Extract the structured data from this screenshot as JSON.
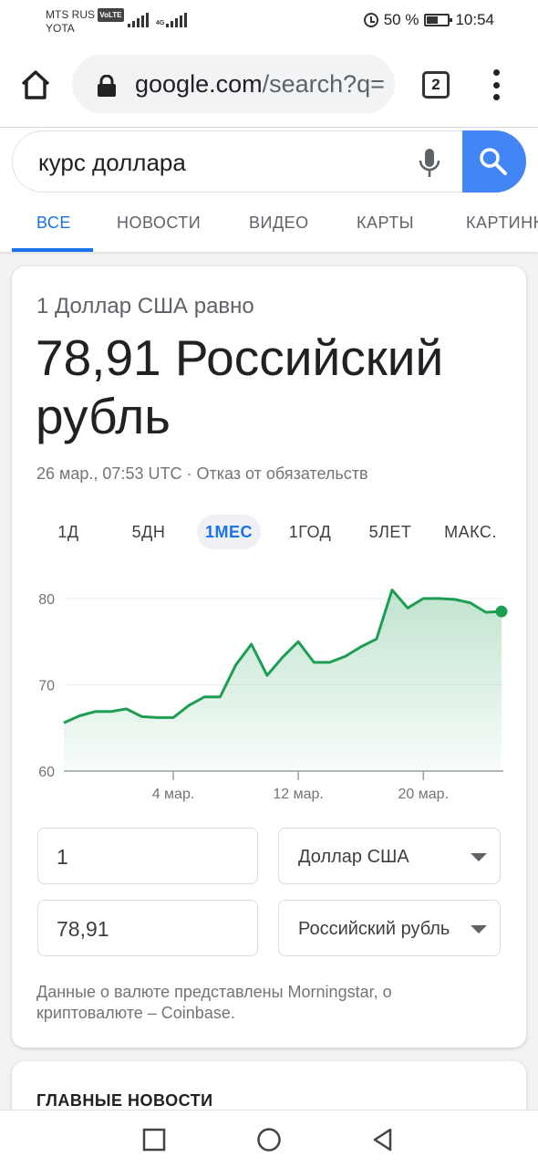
{
  "status_bar": {
    "carrier1": "MTS RUS",
    "volte": "VoLTE",
    "carrier2": "YOTA",
    "network": "4G",
    "battery": "50 %",
    "time": "10:54"
  },
  "browser": {
    "url_host": "google.com",
    "url_path": "/search?q=",
    "tab_count": "2",
    "icons": [
      "home-icon",
      "lock-icon",
      "tabs-icon",
      "more-vert-icon"
    ]
  },
  "search": {
    "query": "курс доллара",
    "tabs": [
      "ВСЕ",
      "НОВОСТИ",
      "ВИДЕО",
      "КАРТЫ",
      "КАРТИНКИ"
    ],
    "active_tab": "ВСЕ",
    "accent_color": "#1a73e8",
    "button_color": "#4285f4"
  },
  "converter": {
    "from_text": "1 Доллар США равно",
    "to_text": "78,91 Российский рубль",
    "meta": "26 мар., 07:53 UTC · Отказ от обязательств",
    "ranges": [
      "1Д",
      "5ДН",
      "1МЕС",
      "1ГОД",
      "5ЛЕТ",
      "МАКС."
    ],
    "active_range": "1МЕС",
    "amount_from": "1",
    "currency_from": "Доллар США",
    "amount_to": "78,91",
    "currency_to": "Российский рубль",
    "source": "Данные о валюте представлены Morningstar, о криптовалюте – Coinbase."
  },
  "chart_data": {
    "type": "area",
    "line_color": "#1e9e53",
    "ylim": [
      60,
      82
    ],
    "yticks": [
      "60",
      "70",
      "80"
    ],
    "xticks": [
      {
        "label": "4 мар.",
        "x": 7
      },
      {
        "label": "12 мар.",
        "x": 15
      },
      {
        "label": "20 мар.",
        "x": 23
      }
    ],
    "x": [
      0,
      1,
      2,
      3,
      4,
      5,
      6,
      7,
      8,
      9,
      10,
      11,
      12,
      13,
      14,
      15,
      16,
      17,
      18,
      19,
      20,
      21,
      22,
      23,
      24,
      25,
      26,
      27,
      28
    ],
    "values": [
      65.6,
      66.4,
      66.9,
      66.9,
      67.2,
      66.3,
      66.2,
      66.2,
      67.6,
      68.6,
      68.6,
      72.3,
      74.7,
      71.1,
      73.2,
      75.0,
      72.6,
      72.6,
      73.3,
      74.4,
      75.3,
      81.0,
      78.9,
      80.0,
      80.0,
      79.9,
      79.5,
      78.4,
      78.5
    ]
  },
  "news": {
    "title": "ГЛАВНЫЕ НОВОСТИ"
  },
  "nav": {
    "icons": [
      "recent-apps-icon",
      "home-circle-icon",
      "back-icon"
    ]
  }
}
